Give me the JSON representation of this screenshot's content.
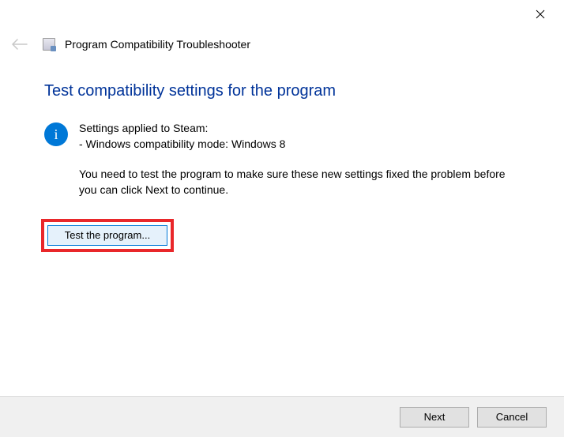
{
  "header": {
    "title": "Program Compatibility Troubleshooter"
  },
  "page": {
    "title": "Test compatibility settings for the program"
  },
  "info": {
    "settings_applied": "Settings applied to Steam:",
    "compat_mode": "- Windows compatibility mode: Windows 8",
    "instruction": "You need to test the program to make sure these new settings fixed the problem before you can click Next to continue."
  },
  "buttons": {
    "test": "Test the program...",
    "next": "Next",
    "cancel": "Cancel"
  }
}
